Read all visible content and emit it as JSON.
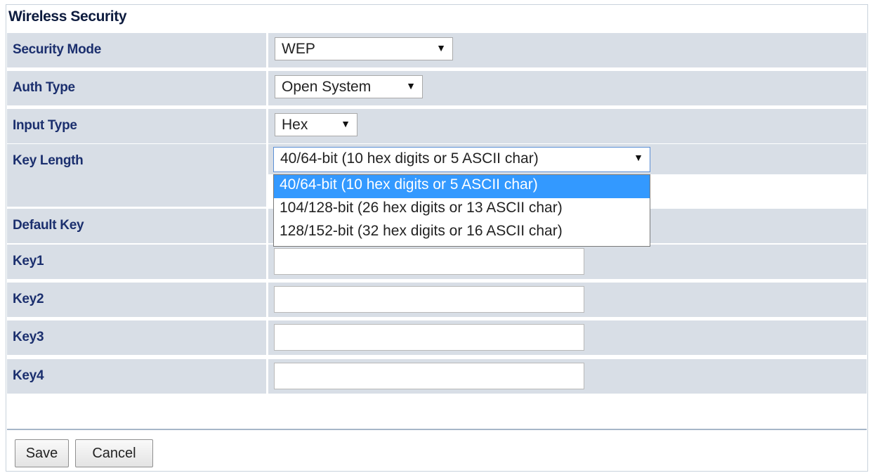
{
  "section": {
    "title": "Wireless Security"
  },
  "fields": {
    "security_mode": {
      "label": "Security Mode",
      "value": "WEP"
    },
    "auth_type": {
      "label": "Auth Type",
      "value": "Open System"
    },
    "input_type": {
      "label": "Input Type",
      "value": "Hex"
    },
    "key_length": {
      "label": "Key Length",
      "value": "40/64-bit (10 hex digits or 5 ASCII char)",
      "options": [
        "40/64-bit (10 hex digits or 5 ASCII char)",
        "104/128-bit (26 hex digits or 13 ASCII char)",
        "128/152-bit (32 hex digits or 16 ASCII char)"
      ],
      "highlighted_option": 0
    },
    "default_key": {
      "label": "Default Key"
    },
    "key1": {
      "label": "Key1",
      "value": ""
    },
    "key2": {
      "label": "Key2",
      "value": ""
    },
    "key3": {
      "label": "Key3",
      "value": ""
    },
    "key4": {
      "label": "Key4",
      "value": ""
    }
  },
  "buttons": {
    "save": "Save",
    "cancel": "Cancel"
  },
  "icons": {
    "dropdown_arrow": "▼"
  },
  "colors": {
    "row_background": "#d8dee6",
    "label_text": "#1b2f6e",
    "highlight": "#3399ff"
  }
}
